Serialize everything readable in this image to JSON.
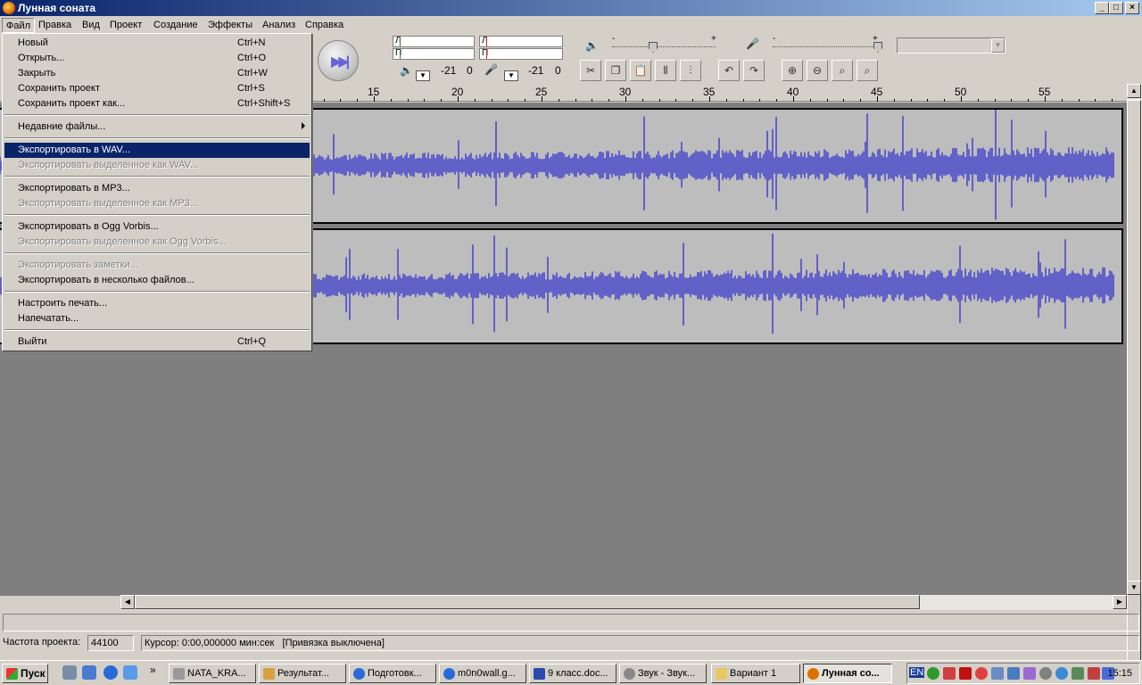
{
  "window": {
    "title": "Лунная соната",
    "min": "_",
    "max": "□",
    "close": "×"
  },
  "menubar": [
    "Файл",
    "Правка",
    "Вид",
    "Проект",
    "Создание",
    "Эффекты",
    "Анализ",
    "Справка"
  ],
  "toolbar": {
    "meter_left": "Л",
    "meter_right": "П",
    "out_db": "-21",
    "out_zero": "0",
    "in_db": "-21",
    "in_zero": "0",
    "minus": "-",
    "plus": "+"
  },
  "ruler": {
    "labels": [
      "15",
      "20",
      "25",
      "30",
      "35",
      "40",
      "45",
      "50",
      "55"
    ]
  },
  "file_menu": {
    "items": [
      {
        "label": "Новый",
        "shortcut": "Ctrl+N"
      },
      {
        "label": "Открыть...",
        "shortcut": "Ctrl+O"
      },
      {
        "label": "Закрыть",
        "shortcut": "Ctrl+W"
      },
      {
        "label": "Сохранить проект",
        "shortcut": "Ctrl+S"
      },
      {
        "label": "Сохранить проект как...",
        "shortcut": "Ctrl+Shift+S"
      },
      {
        "label": "Недавние файлы...",
        "shortcut": ""
      },
      {
        "label": "Экспортировать в WAV...",
        "shortcut": ""
      },
      {
        "label": "Экспортировать выделенное как WAV...",
        "shortcut": ""
      },
      {
        "label": "Экспортировать в MP3...",
        "shortcut": ""
      },
      {
        "label": "Экспортировать выделенное как MP3...",
        "shortcut": ""
      },
      {
        "label": "Экспортировать в Ogg Vorbis...",
        "shortcut": ""
      },
      {
        "label": "Экспортировать выделенное как Ogg Vorbis...",
        "shortcut": ""
      },
      {
        "label": "Экспортировать заметки...",
        "shortcut": ""
      },
      {
        "label": "Экспортировать в несколько файлов...",
        "shortcut": ""
      },
      {
        "label": "Настроить печать...",
        "shortcut": ""
      },
      {
        "label": "Напечатать...",
        "shortcut": ""
      },
      {
        "label": "Выйти",
        "shortcut": "Ctrl+Q"
      }
    ]
  },
  "status": {
    "rate_label": "Частота проекта:",
    "rate_value": "44100",
    "cursor": "Курсор: 0:00,000000 мин:сек",
    "snap": "[Привязка выключена]"
  },
  "taskbar": {
    "start": "Пуск",
    "more": "»",
    "tasks": [
      "NATA_KRA...",
      "Результат...",
      "Подготовк...",
      "m0n0wall.g...",
      "9 класс.doc...",
      "Звук - Звук...",
      "Вариант 1",
      "Лунная со..."
    ],
    "lang": "EN",
    "clock": "15:15"
  },
  "colors": {
    "waveform": "#3a3acc",
    "selection": "#0a246a",
    "title_start": "#0a246a"
  }
}
